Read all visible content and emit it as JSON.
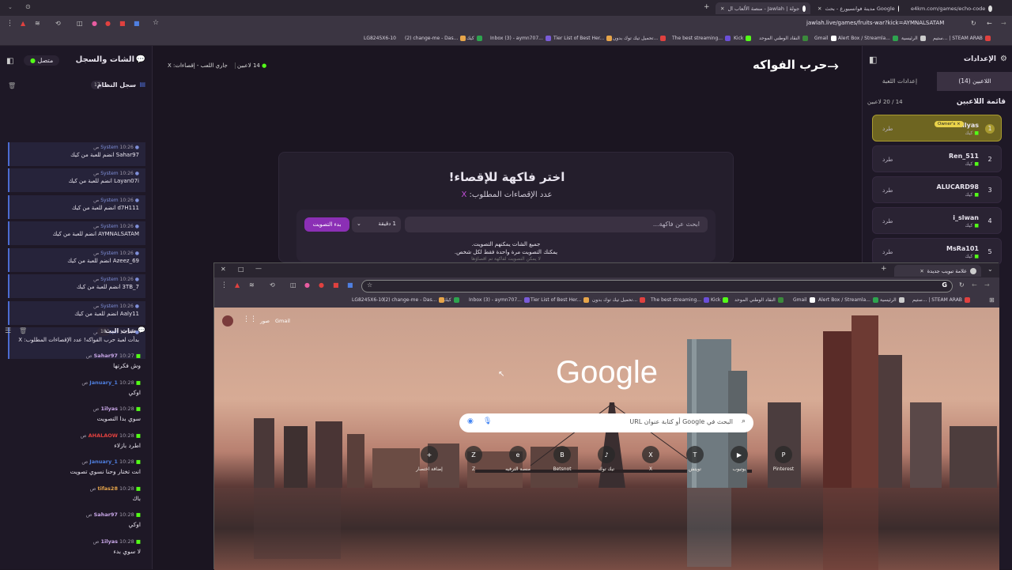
{
  "outer_browser": {
    "tabs": [
      {
        "label": "e4km.com/games/echo-code"
      },
      {
        "label": "Google مدينة فوانسيورع - بحث"
      },
      {
        "label": "جولة | Jawlah - منصة الألعاب ال"
      }
    ],
    "new_tab": "+",
    "url": "jawlah.live/games/fruits-war?kick=AYMNALSATAM",
    "bookmarks": [
      "ستيم... | STEAM ARAB",
      "الرئيسية",
      "Alert Box / Streamla...",
      "Gmail",
      "النقاد الوطني الموحد",
      "Kick",
      "The best streaming...",
      "تحميل تيك توك بدون...",
      "Tier List of Best Her...",
      "Inbox (3) - aymn707...",
      "كيك",
      "(2) change-me - Das...",
      "LG8245X6-10"
    ]
  },
  "left_panel": {
    "title": "الشات والسجل",
    "status": "متصل",
    "system_log": {
      "title": "سجل النظام",
      "count": "17",
      "messages": [
        {
          "sender": "System",
          "time": "10:26 ص",
          "text": "Sahar97 انضم للعبة من كيك"
        },
        {
          "sender": "System",
          "time": "10:26 ص",
          "text": "Layan07i انضم للعبة من كيك"
        },
        {
          "sender": "System",
          "time": "10:26 ص",
          "text": "d7H111 انضم للعبة من كيك"
        },
        {
          "sender": "System",
          "time": "10:26 ص",
          "text": "AYMNALSATAM انضم للعبة من كيك"
        },
        {
          "sender": "System",
          "time": "10:26 ص",
          "text": "Azeez_69 انضم للعبة من كيك"
        },
        {
          "sender": "System",
          "time": "10:26 ص",
          "text": "3TB_7 انضم للعبة من كيك"
        },
        {
          "sender": "System",
          "time": "10:26 ص",
          "text": "Aaly11 انضم للعبة من كيك"
        },
        {
          "sender": "System",
          "time": "10:27 ص",
          "text": "بدأت لعبة حرب الفواكه! عدد الإقصاءات المطلوب: X"
        }
      ]
    },
    "live_chat": {
      "title": "شات البث",
      "count": "18",
      "messages": [
        {
          "user": "Sahar97",
          "time": "10:27 ص",
          "text": "وش فكرتها",
          "color": "#c9a7e8"
        },
        {
          "user": "January_1",
          "time": "10:28 ص",
          "text": "اوكي",
          "color": "#4f7fe0"
        },
        {
          "user": "1ilyas",
          "time": "10:28 ص",
          "text": "سوي بدا التصويت",
          "color": "#c9a7e8"
        },
        {
          "user": "AHALAOW",
          "time": "10:28 ص",
          "text": "اطرد بازلاء",
          "color": "#e0413f"
        },
        {
          "user": "January_1",
          "time": "10:28 ص",
          "text": "انت تختار وحنا نسوي تصويت",
          "color": "#4f7fe0"
        },
        {
          "user": "tifas28",
          "time": "10:28 ص",
          "text": "باك",
          "color": "#e7a54a"
        },
        {
          "user": "Sahar97",
          "time": "10:28 ص",
          "text": "اوكي",
          "color": "#c9a7e8"
        },
        {
          "user": "1ilyas",
          "time": "10:28 ص",
          "text": "لا سوي بدء",
          "color": "#c9a7e8"
        }
      ]
    }
  },
  "header": {
    "game_title": "حرب الفواكه",
    "players_online": "14 لاعبين",
    "status": "جاري اللعب - إقصاءات: X"
  },
  "center": {
    "title": "اختر فاكهة للإقصاء!",
    "subtitle": "عدد الإقصاءات المطلوب:",
    "subtitle_value": "X",
    "search_placeholder": "ابحث عن فاكهة...",
    "duration": "1 دقيقة",
    "start_vote": "بدء التصويت",
    "note1": "جميع الشات يمكنهم التصويت.",
    "note2": "يمكنك التصويت مرة واحدة فقط لكل شخص.",
    "note3": "لا يمكن التصويت لفاكهة تم اقصاؤها"
  },
  "right_panel": {
    "title": "الإعدادات",
    "tabs": [
      {
        "label": "اللاعبين (14)"
      },
      {
        "label": "إعدادات اللعبة"
      }
    ],
    "list_title": "قائمة اللاعبين",
    "list_count": "14 / 20 لاعبين",
    "kick_label": "طرد",
    "players": [
      {
        "rank": "1",
        "name": "1ilyas",
        "sub": "كيك",
        "badge": "Owner's"
      },
      {
        "rank": "2",
        "name": "Ren_511",
        "sub": "كيك"
      },
      {
        "rank": "3",
        "name": "ALUCARD98",
        "sub": "كيك"
      },
      {
        "rank": "4",
        "name": "i_slwan",
        "sub": "كيك"
      },
      {
        "rank": "5",
        "name": "MsRa101",
        "sub": "كيك"
      }
    ]
  },
  "inner_browser": {
    "tab_label": "علامة تبويب جديدة",
    "bookmarks": [
      "ستيم... | STEAM ARAB",
      "الرئيسية",
      "Alert Box / Streamla...",
      "Gmail",
      "النقاد الوطني الموحد",
      "Kick",
      "The best streaming...",
      "تحميل تيك توك بدون...",
      "Tier List of Best Her...",
      "Inbox (3) - aymn707...",
      "كيك",
      "(2) change-me - Das...",
      "LG8245X6-10"
    ],
    "gmail_label": "Gmail",
    "images_label": "صور",
    "google_logo": "Google",
    "search_placeholder": "البحث في Google أو كتابة عنوان URL",
    "shortcuts": [
      {
        "label": "إضافة اختصار",
        "icon": "+"
      },
      {
        "label": "Z",
        "icon": "Z"
      },
      {
        "label": "منصة الترفيه",
        "icon": "e"
      },
      {
        "label": "Betsnot",
        "icon": "B"
      },
      {
        "label": "تيك توك",
        "icon": "♪"
      },
      {
        "label": "X",
        "icon": "X"
      },
      {
        "label": "تويتش",
        "icon": "T"
      },
      {
        "label": "يوتيوب",
        "icon": "▶"
      },
      {
        "label": "Pinterest",
        "icon": "P"
      }
    ]
  }
}
